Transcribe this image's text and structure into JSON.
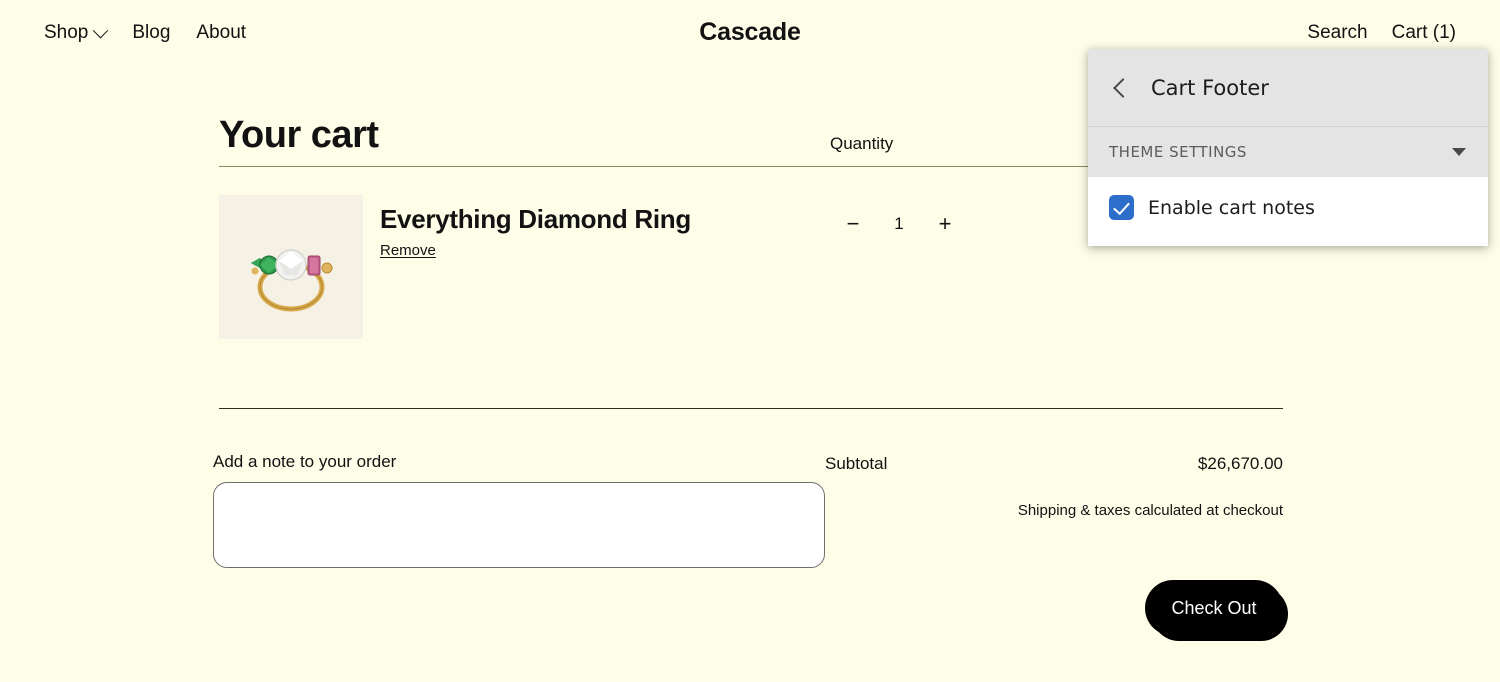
{
  "store": {
    "title": "Cascade",
    "nav": [
      {
        "label": "Shop",
        "has_dropdown": true
      },
      {
        "label": "Blog",
        "has_dropdown": false
      },
      {
        "label": "About",
        "has_dropdown": false
      }
    ],
    "utility": {
      "search": "Search",
      "cart": "Cart (1)"
    }
  },
  "cart": {
    "heading": "Your cart",
    "columns": {
      "quantity": "Quantity"
    },
    "item": {
      "title": "Everything Diamond Ring",
      "remove": "Remove",
      "quantity": "1",
      "decrease": "−",
      "increase": "+"
    },
    "note": {
      "label": "Add a note to your order",
      "value": "",
      "placeholder": ""
    },
    "totals": {
      "subtotal_label": "Subtotal",
      "subtotal_value": "$26,670.00",
      "tax_note": "Shipping & taxes calculated at checkout"
    },
    "checkout_label": "Check Out"
  },
  "editor": {
    "back_icon": "chevron-left-icon",
    "title": "Cart Footer",
    "section": {
      "label": "THEME SETTINGS",
      "caret_icon": "caret-down-icon",
      "expanded": true
    },
    "settings": [
      {
        "label": "Enable cart notes",
        "checked": true
      }
    ]
  },
  "colors": {
    "page_background": "#fdfde8",
    "text": "#121212",
    "panel_header": "#e4e4e4",
    "panel_body": "#ffffff",
    "checkbox_accent": "#2d6ecb",
    "checkout_background": "#000000"
  }
}
